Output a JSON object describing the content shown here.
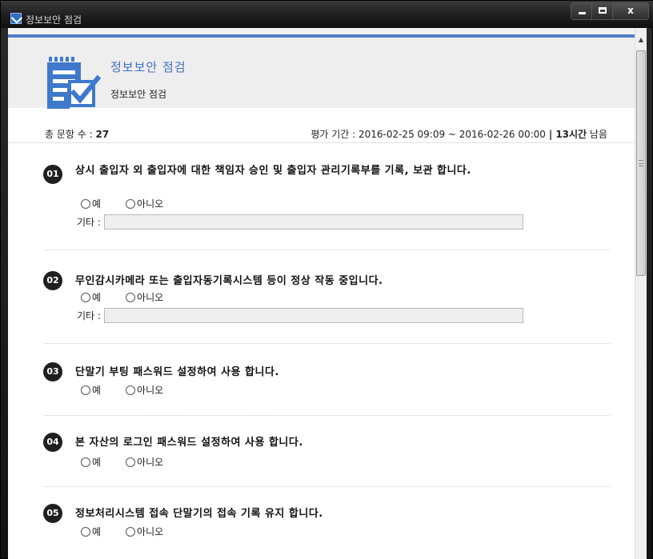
{
  "window": {
    "title": "정보보안 점검",
    "close_label": "x"
  },
  "header": {
    "title": "정보보안 점검",
    "subtitle": "정보보안 점검"
  },
  "info": {
    "total_label": "총 문항 수 : ",
    "total_value": "27",
    "period_label": "평가 기간 : 2016-02-25 09:09 ~ 2016-02-26 00:00",
    "separator": "|",
    "remaining_strong": "13시간",
    "remaining_suffix": " 남음"
  },
  "options": {
    "yes": "예",
    "no": "아니오"
  },
  "etc_label": "기타 :",
  "questions": [
    {
      "num": "01",
      "text": "상시 출입자 외 출입자에 대한 책임자 승인 및 출입자 관리기록부를 기록, 보관 합니다."
    },
    {
      "num": "02",
      "text": "무인감시카메라 또는 출입자동기록시스템 등이 정상 작동 중입니다."
    },
    {
      "num": "03",
      "text": "단말기 부팅 패스워드 설정하여 사용 합니다."
    },
    {
      "num": "04",
      "text": "본 자산의 로그인 패스워드 설정하여 사용 합니다."
    },
    {
      "num": "05",
      "text": "정보처리시스템 접속 단말기의 접속 기록 유지 합니다."
    }
  ],
  "colors": {
    "accent": "#4d7fc8",
    "title_text": "#3f6fc0",
    "number_badge": "#1f1f1f"
  }
}
